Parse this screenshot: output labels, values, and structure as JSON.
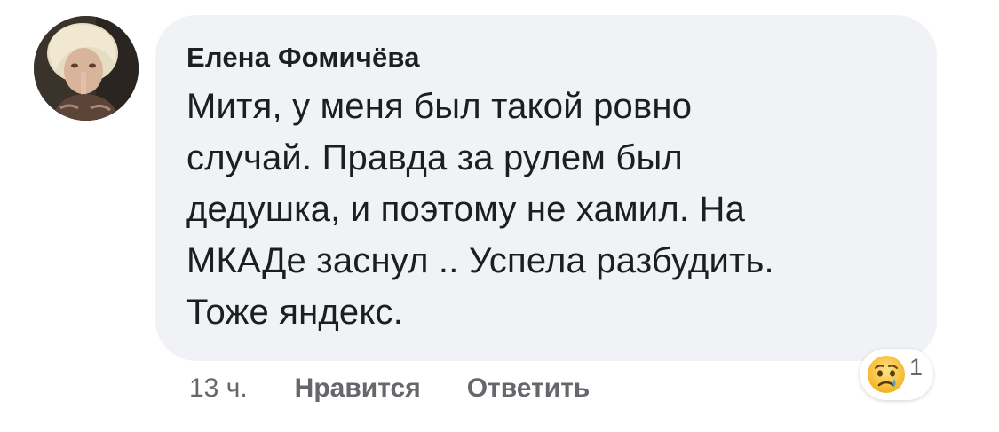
{
  "comment": {
    "author_name": "Елена Фомичёва",
    "text": "Митя, у меня был такой ровно\nслучай. Правда за рулем был\nдедушка, и поэтому не хамил. На\nМКАДе заснул .. Успела разбудить.\nТоже яндекс.",
    "timestamp": "13 ч.",
    "actions": {
      "like_label": "Нравится",
      "reply_label": "Ответить"
    },
    "reactions": {
      "icon": "sad-crying-face-icon",
      "count": "1"
    }
  },
  "colors": {
    "bubble_background": "#f0f2f5",
    "text": "#1c1e21",
    "meta_text": "#65676b",
    "reaction_emoji": "#f7b125"
  }
}
